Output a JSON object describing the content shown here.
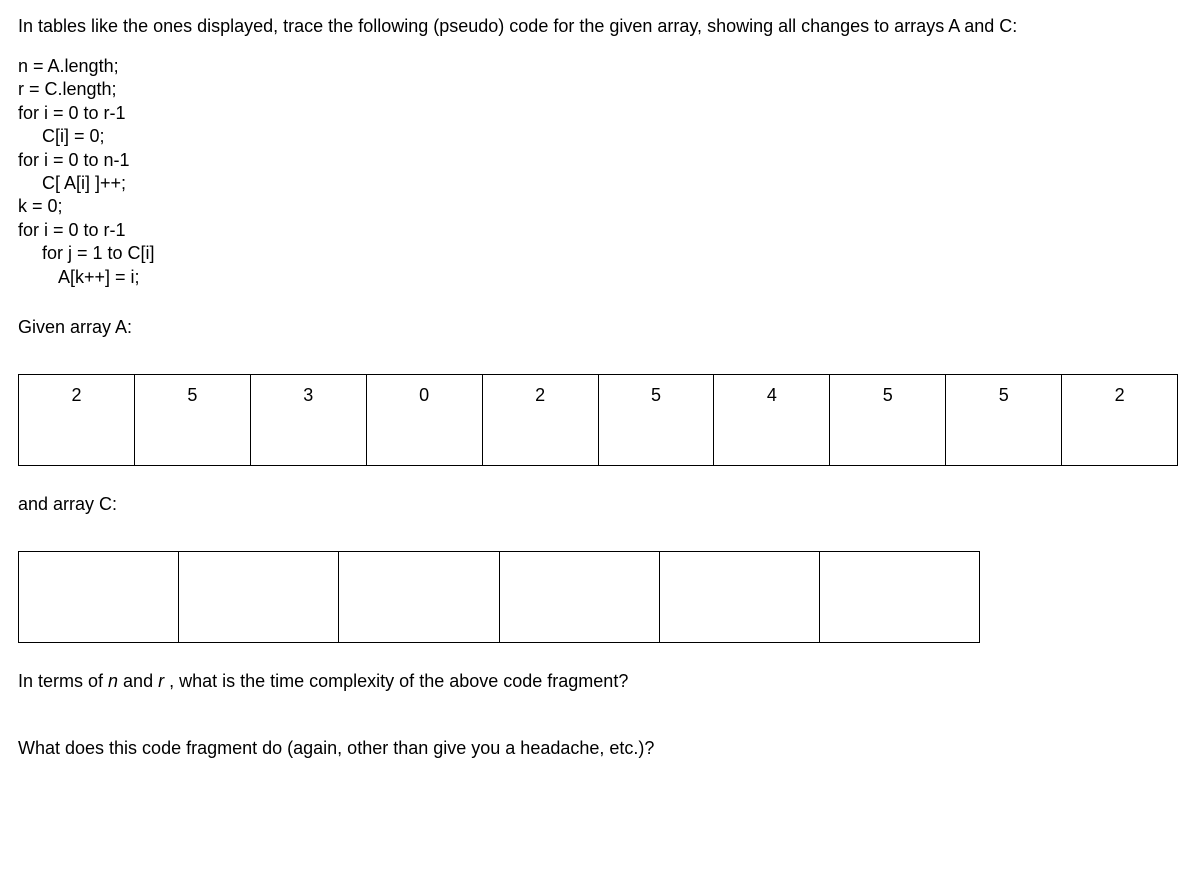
{
  "intro": "In tables like the ones displayed, trace the following (pseudo) code for the given array, showing all changes to arrays A and C:",
  "code": {
    "l1": "n = A.length;",
    "l2": "r = C.length;",
    "l3": "for i = 0 to r-1",
    "l4": "C[i] = 0;",
    "l5": "for i = 0 to n-1",
    "l6": "C[ A[i] ]++;",
    "l7": "k = 0;",
    "l8": "for i = 0 to r-1",
    "l9": "for j = 1 to C[i]",
    "l10": "A[k++] = i;"
  },
  "labelA": "Given array A:",
  "arrayA": [
    "2",
    "5",
    "3",
    "0",
    "2",
    "5",
    "4",
    "5",
    "5",
    "2"
  ],
  "labelC": "and array C:",
  "arrayC": [
    "",
    "",
    "",
    "",
    "",
    ""
  ],
  "q1_pre": "In terms of ",
  "q1_n": "n",
  "q1_mid": " and ",
  "q1_r": "r",
  "q1_post": " , what is the time complexity of the above code fragment?",
  "q2": "What does this code fragment do (again, other than give you a headache, etc.)?"
}
